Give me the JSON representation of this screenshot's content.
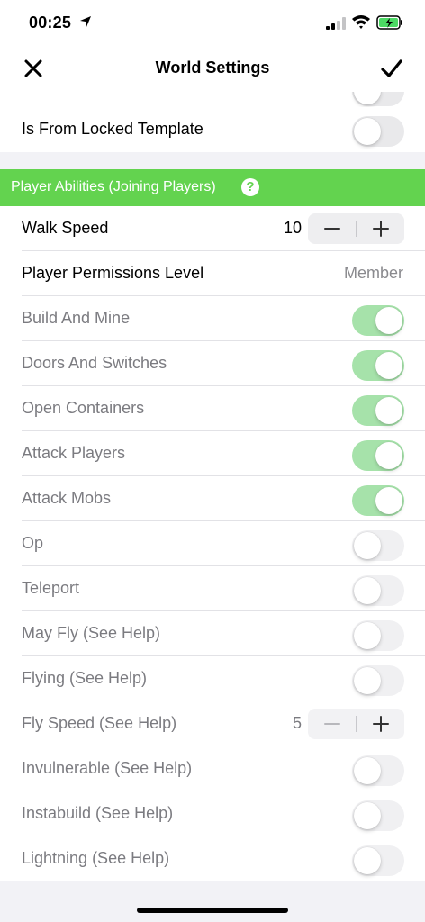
{
  "status_bar": {
    "time": "00:25"
  },
  "nav": {
    "title": "World Settings"
  },
  "rows_top": [
    {
      "label": "Is From Locked Template"
    }
  ],
  "section": {
    "title": "Player Abilities (Joining Players)",
    "help": "?"
  },
  "walk_speed": {
    "label": "Walk Speed",
    "value": "10"
  },
  "permissions": {
    "label": "Player Permissions Level",
    "value": "Member"
  },
  "abilities": [
    {
      "label": "Build And Mine",
      "on": true
    },
    {
      "label": "Doors And Switches",
      "on": true
    },
    {
      "label": "Open Containers",
      "on": true
    },
    {
      "label": "Attack Players",
      "on": true
    },
    {
      "label": "Attack Mobs",
      "on": true
    },
    {
      "label": "Op",
      "on": false
    },
    {
      "label": "Teleport",
      "on": false
    },
    {
      "label": "May Fly (See Help)",
      "on": false
    },
    {
      "label": "Flying (See Help)",
      "on": false
    }
  ],
  "fly_speed": {
    "label": "Fly Speed (See Help)",
    "value": "5"
  },
  "abilities_bottom": [
    {
      "label": "Invulnerable (See Help)",
      "on": false
    },
    {
      "label": "Instabuild (See Help)",
      "on": false
    },
    {
      "label": "Lightning (See Help)",
      "on": false
    }
  ],
  "colors": {
    "accent_green": "#63D34F",
    "toggle_on": "#A6E2AA",
    "toggle_off": "#E9E9EB"
  }
}
